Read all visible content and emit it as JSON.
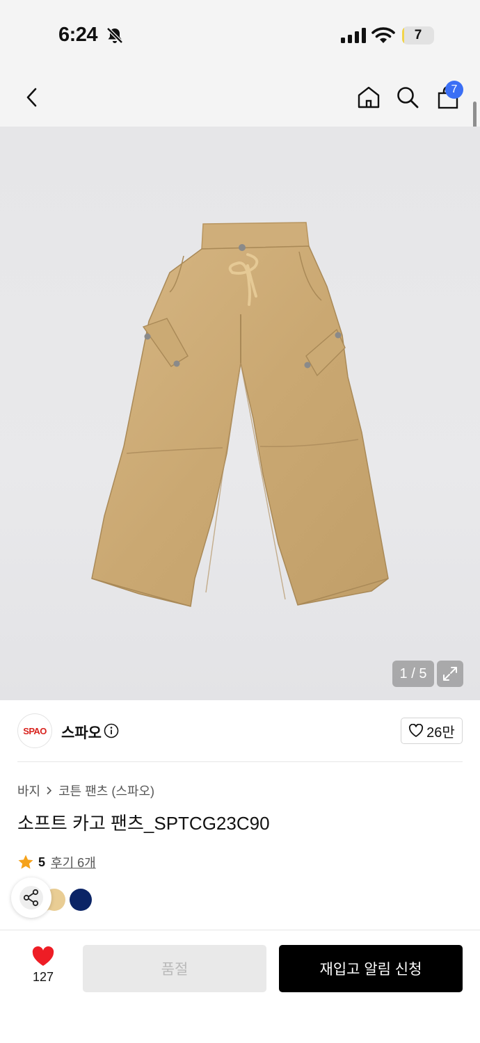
{
  "status_bar": {
    "time": "6:24",
    "battery_level": "7",
    "battery_fraction": 0.07,
    "icons": [
      "bell-slash-icon",
      "signal-icon",
      "wifi-icon",
      "battery-icon"
    ]
  },
  "nav": {
    "icons": [
      "chevron-left-icon",
      "home-icon",
      "search-icon",
      "shopping-bag-icon"
    ],
    "cart_count": "7"
  },
  "gallery": {
    "counter": "1 / 5",
    "current": 1,
    "total": 5,
    "icon": "expand-icon"
  },
  "brand": {
    "logo_text": "SPAO",
    "name": "스파오",
    "likes": "26만",
    "logo_color": "#d8231e"
  },
  "product": {
    "breadcrumb": [
      "바지",
      "코튼 팬츠 (스파오)"
    ],
    "title": "소프트 카고 팬츠_SPTCG23C90",
    "rating": "5",
    "reviews_label": "후기 6개",
    "swatches": [
      "#f1d9a7",
      "#e9cd94",
      "#0b2466"
    ]
  },
  "bottom_bar": {
    "wish_count": "127",
    "soldout_label": "품절",
    "restock_label": "재입고 알림 신청",
    "heart_color": "#ee1d25"
  }
}
